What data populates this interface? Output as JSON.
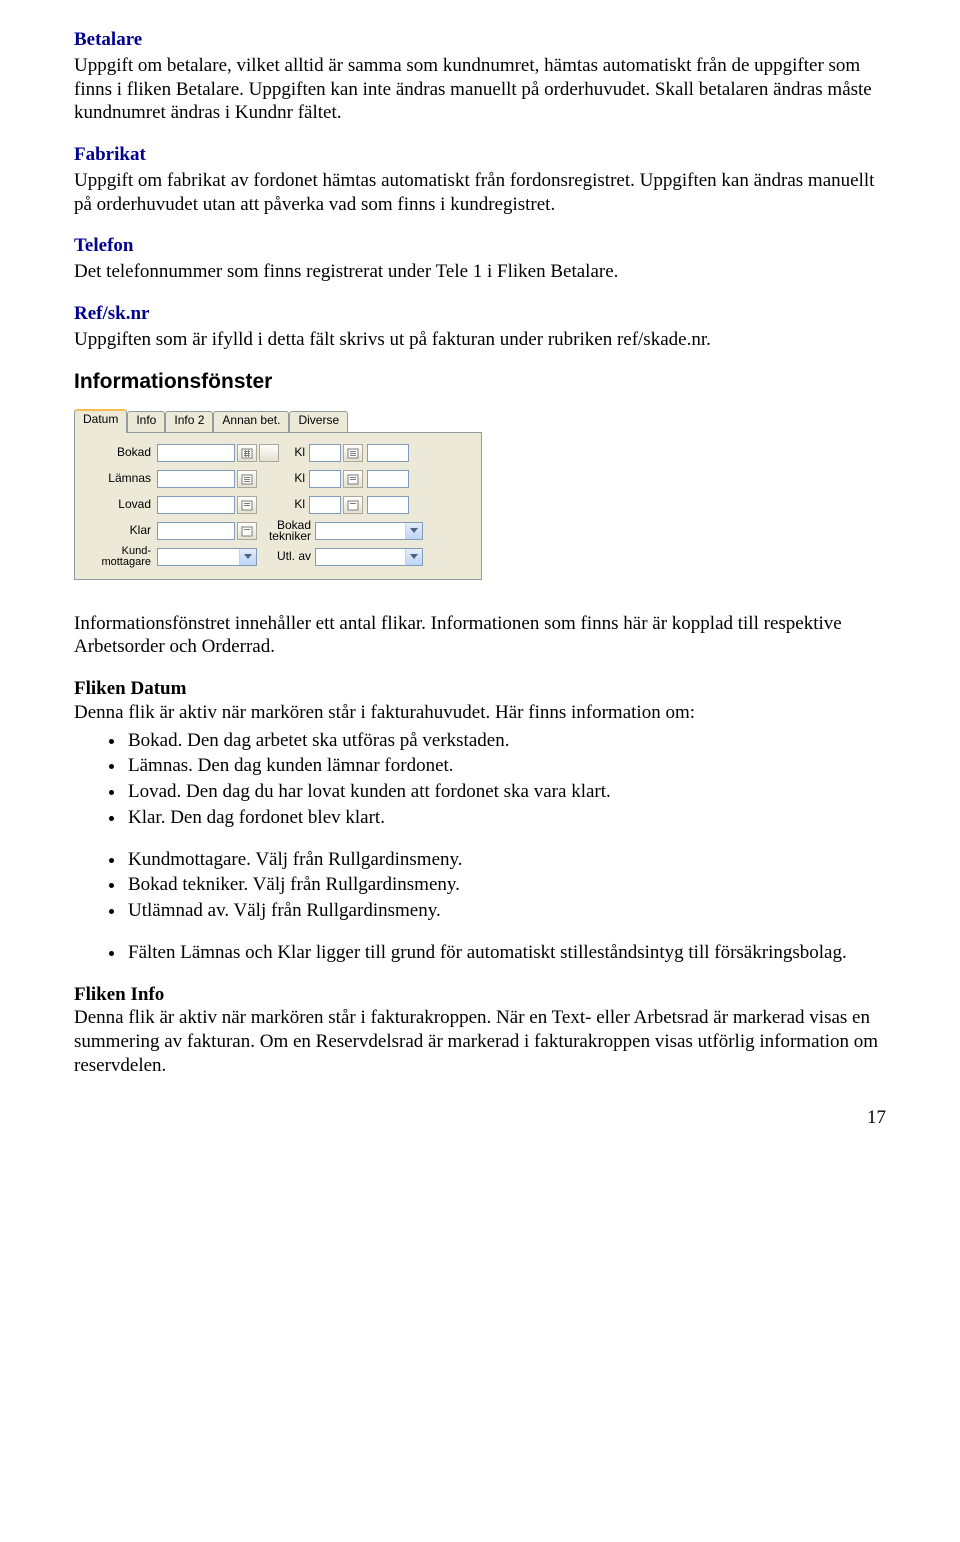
{
  "betalare": {
    "heading": "Betalare",
    "body": "Uppgift om betalare, vilket alltid är samma som kundnumret, hämtas automatiskt från de uppgifter som finns i fliken Betalare. Uppgiften kan inte ändras manuellt på orderhuvudet. Skall betalaren ändras måste kundnumret ändras i Kundnr fältet."
  },
  "fabrikat": {
    "heading": "Fabrikat",
    "body": "Uppgift om fabrikat av fordonet hämtas automatiskt från fordonsregistret. Uppgiften kan ändras manuellt på orderhuvudet utan att påverka vad som finns i kundregistret."
  },
  "telefon": {
    "heading": "Telefon",
    "body": "Det telefonnummer som finns registrerat under Tele 1 i Fliken Betalare."
  },
  "refsk": {
    "heading": "Ref/sk.nr",
    "body": "Uppgiften som är ifylld i detta fält skrivs ut på fakturan under rubriken ref/skade.nr."
  },
  "informationsfonster": {
    "title": "Informationsfönster"
  },
  "tabs": {
    "t0": "Datum",
    "t1": "Info",
    "t2": "Info 2",
    "t3": "Annan bet.",
    "t4": "Diverse"
  },
  "panel": {
    "bokad": "Bokad",
    "lamnas": "Lämnas",
    "lovad": "Lovad",
    "klar": "Klar",
    "kundmottagare": "Kund-\nmottagare",
    "kl": "Kl",
    "bokad_tekniker": "Bokad\ntekniker",
    "utl_av": "Utl. av"
  },
  "info_body": "Informationsfönstret innehåller ett antal flikar. Informationen som finns här är kopplad till respektive Arbetsorder och Orderrad.",
  "fliken_datum": {
    "heading": "Fliken Datum",
    "body": "Denna flik är aktiv när markören står i fakturahuvudet. Här finns information om:"
  },
  "bullets1": {
    "b0": "Bokad. Den dag arbetet ska utföras på verkstaden.",
    "b1": "Lämnas. Den dag kunden lämnar fordonet.",
    "b2": "Lovad. Den dag du har lovat kunden att fordonet ska vara klart.",
    "b3": "Klar. Den dag fordonet blev klart."
  },
  "bullets2": {
    "b0": "Kundmottagare. Välj från Rullgardinsmeny.",
    "b1": "Bokad tekniker. Välj från Rullgardinsmeny.",
    "b2": "Utlämnad av. Välj från Rullgardinsmeny."
  },
  "bullets3": {
    "b0": "Fälten Lämnas och Klar ligger till grund för automatiskt stilleståndsintyg till försäkringsbolag."
  },
  "fliken_info": {
    "heading": "Fliken Info",
    "body": "Denna flik är aktiv när markören står i fakturakroppen. När en Text- eller Arbetsrad är markerad visas en summering av fakturan. Om en Reservdelsrad är markerad i fakturakroppen visas utförlig information om reservdelen."
  },
  "page_number": "17"
}
